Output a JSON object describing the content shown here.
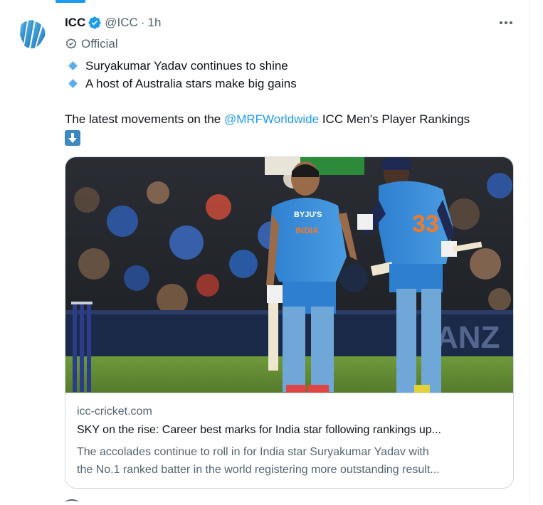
{
  "tweet": {
    "author_name": "ICC",
    "author_handle": "@ICC",
    "separator": "·",
    "time": "1h",
    "official_label": "Official",
    "bullets": [
      "Suryakumar Yadav continues to shine",
      "A host of Australia stars make big gains"
    ],
    "text_prefix": "The latest movements on the ",
    "mention": "@MRFWorldwide",
    "text_suffix": " ICC Men's Player Rankings",
    "emoji": "down-arrow-emoji"
  },
  "card": {
    "domain": "icc-cricket.com",
    "title": "SKY on the rise: Career best marks for India star following rankings up...",
    "description_line1": "The accolades continue to roll in for India star Suryakumar Yadav with",
    "description_line2": "the No.1 ranked batter in the world registering more outstanding result...",
    "image": {
      "scoreboard_text": "ANZ",
      "jersey_number": "33",
      "jersey_brand": "BYJU'S",
      "jersey_country": "INDIA"
    }
  },
  "colors": {
    "accent": "#1d9bf0",
    "text": "#0f1419",
    "secondary_text": "#536471",
    "border": "#cfd9de",
    "jersey": "#3d8fd6",
    "verified": "#1d9bf0"
  },
  "icons": {
    "verified": "verified-badge-icon",
    "official": "official-badge-icon",
    "more": "more-options-icon",
    "bullet": "small-blue-diamond"
  }
}
